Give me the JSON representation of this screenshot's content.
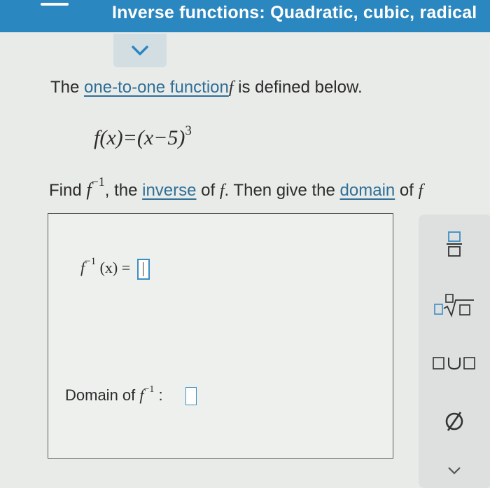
{
  "header": {
    "title": "Inverse functions: Quadratic, cubic, radical"
  },
  "collapse": {
    "icon": "chevron-down-icon"
  },
  "prompt": {
    "intro": "The ",
    "link_one_to_one": "one-to-one function",
    "f_symbol": "f",
    "defined_text": " is defined below."
  },
  "formula": {
    "lhs": "f(x)=(x−5)",
    "exponent": "3"
  },
  "instruction": {
    "find": "Find ",
    "f_symbol": "f",
    "sup": "−1",
    "comma_the": ", the ",
    "link_inverse": "inverse",
    "of_text": " of ",
    "f_symbol2": "f",
    "then_text": ". Then give the ",
    "link_domain": "domain",
    "of_text2": " of ",
    "f_symbol3": "f"
  },
  "answer": {
    "eq_f": "f",
    "eq_sup": "−1",
    "eq_rest": "(x) =",
    "domain_label": "Domain of ",
    "domain_f": "f",
    "domain_sup": "−1",
    "domain_colon": ":"
  },
  "tools": [
    {
      "name": "fraction-icon"
    },
    {
      "name": "nth-root-icon"
    },
    {
      "name": "union-icon"
    },
    {
      "name": "empty-set-icon"
    },
    {
      "name": "chevron-down-icon"
    }
  ],
  "colors": {
    "header_bg": "#2a87bf",
    "link": "#2f6f97",
    "input_border": "#3d8ec4"
  }
}
